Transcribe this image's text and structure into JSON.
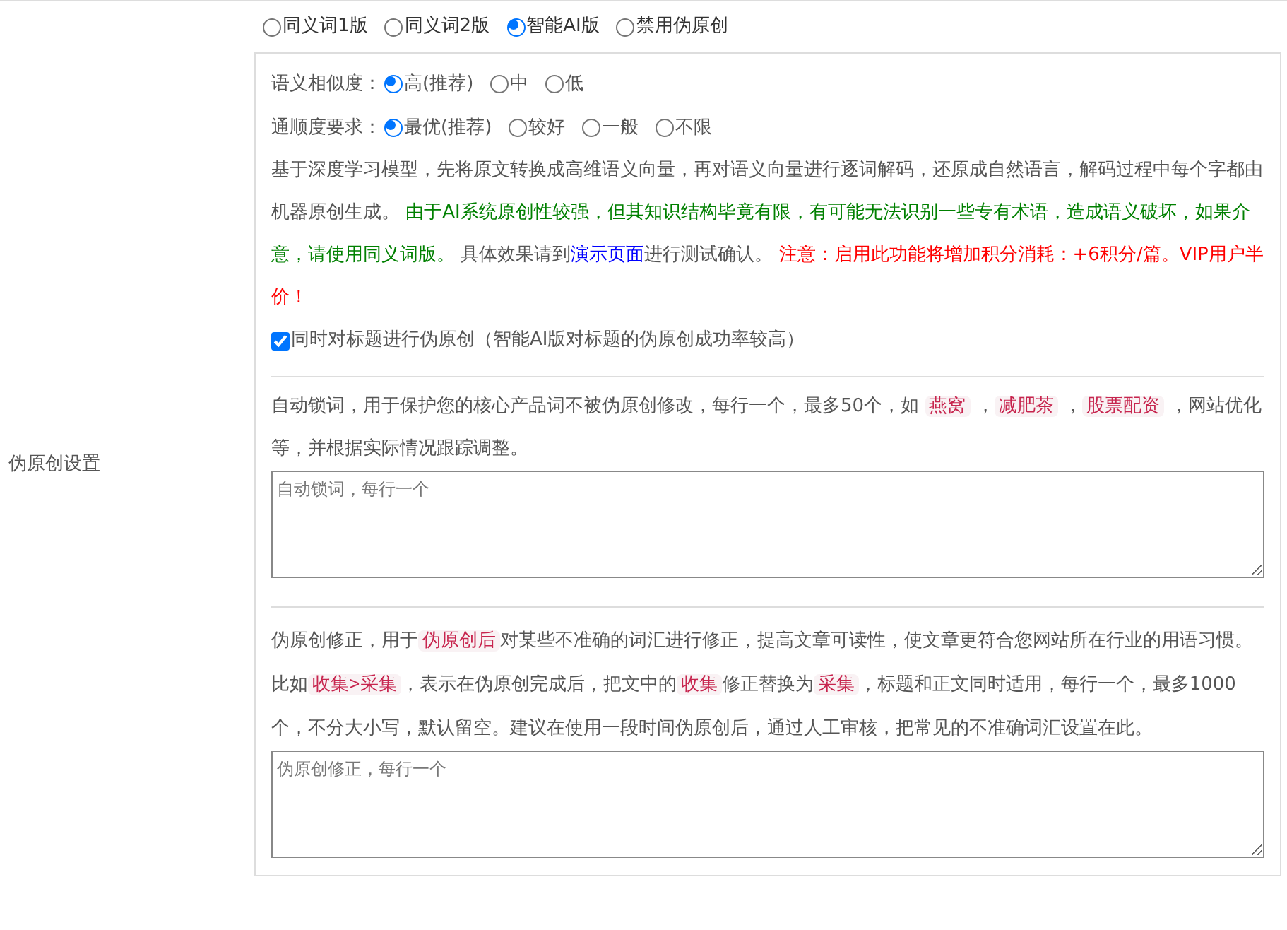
{
  "mode_options": [
    {
      "label": "同义词1版",
      "selected": false
    },
    {
      "label": "同义词2版",
      "selected": false
    },
    {
      "label": "智能AI版",
      "selected": true
    },
    {
      "label": "禁用伪原创",
      "selected": false
    }
  ],
  "similarity": {
    "label": "语义相似度：",
    "options": [
      {
        "label": "高(推荐)",
        "selected": true
      },
      {
        "label": "中",
        "selected": false
      },
      {
        "label": "低",
        "selected": false
      }
    ]
  },
  "fluency": {
    "label": "通顺度要求：",
    "options": [
      {
        "label": "最优(推荐)",
        "selected": true
      },
      {
        "label": "较好",
        "selected": false
      },
      {
        "label": "一般",
        "selected": false
      },
      {
        "label": "不限",
        "selected": false
      }
    ]
  },
  "ai_description": [
    {
      "kind": "text",
      "text": "基于深度学习模型，先将原文转换成高维语义向量，再对语义向量进行逐词解码，还原成自然语言，解码过程中每个字都由机器原创生成。 "
    },
    {
      "kind": "success",
      "text": "由于AI系统原创性较强，但其知识结构毕竟有限，有可能无法识别一些专有术语，造成语义破坏，如果介意，请使用同义词版。"
    },
    {
      "kind": "text",
      "text": " 具体效果请到"
    },
    {
      "kind": "link",
      "text": "演示页面"
    },
    {
      "kind": "text",
      "text": "进行测试确认。 "
    },
    {
      "kind": "warning",
      "text": "注意：启用此功能将增加积分消耗：+6积分/篇。VIP用户半价！"
    }
  ],
  "title_option": {
    "label": "同时对标题进行伪原创（智能AI版对标题的伪原创成功率较高）",
    "checked": true
  },
  "section_label": "伪原创设置",
  "lock_words": {
    "description": [
      {
        "kind": "text",
        "text": "自动锁词，用于保护您的核心产品词不被伪原创修改，每行一个，最多50个，如 "
      },
      {
        "kind": "code",
        "text": "燕窝"
      },
      {
        "kind": "text",
        "text": " ，"
      },
      {
        "kind": "code",
        "text": "减肥茶"
      },
      {
        "kind": "text",
        "text": " ，"
      },
      {
        "kind": "code",
        "text": "股票配资"
      },
      {
        "kind": "text",
        "text": " ，网站优化等，并根据实际情况跟踪调整。"
      }
    ],
    "placeholder": "自动锁词，每行一个"
  },
  "corrections": {
    "description": [
      {
        "kind": "text",
        "text": "伪原创修正，用于"
      },
      {
        "kind": "code",
        "text": "伪原创后"
      },
      {
        "kind": "text",
        "text": "对某些不准确的词汇进行修正，提高文章可读性，使文章更符合您网站所在行业的用语习惯。比如"
      },
      {
        "kind": "code",
        "text": "收集>采集"
      },
      {
        "kind": "text",
        "text": "，表示在伪原创完成后，把文中的"
      },
      {
        "kind": "code",
        "text": "收集"
      },
      {
        "kind": "text",
        "text": "修正替换为"
      },
      {
        "kind": "code",
        "text": "采集"
      },
      {
        "kind": "text",
        "text": "，标题和正文同时适用，每行一个，最多1000个，不分大小写，默认留空。建议在使用一段时间伪原创后，通过人工审核，把常见的不准确词汇设置在此。"
      }
    ],
    "placeholder": "伪原创修正，每行一个"
  }
}
